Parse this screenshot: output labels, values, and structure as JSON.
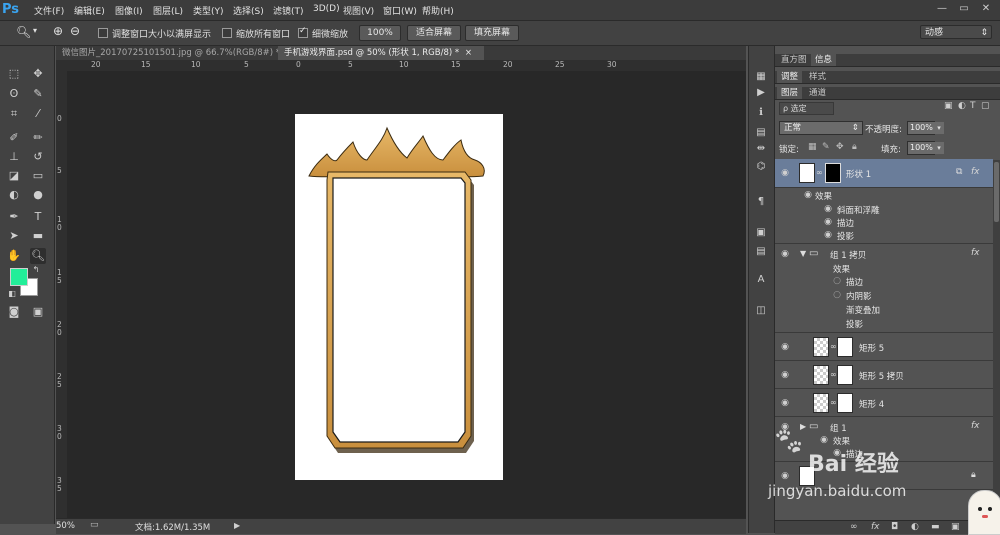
{
  "menubar": {
    "logo": "Ps",
    "items": [
      "文件(F)",
      "编辑(E)",
      "图像(I)",
      "图层(L)",
      "类型(Y)",
      "选择(S)",
      "滤镜(T)",
      "3D(D)",
      "视图(V)",
      "窗口(W)",
      "帮助(H)"
    ],
    "win_controls": [
      "—",
      "▭",
      "✕"
    ]
  },
  "options": {
    "check_resize": "调整窗口大小以满屏显示",
    "check_all_windows": "缩放所有窗口",
    "check_scrubby": "细微缩放",
    "btn_100": "100%",
    "btn_fit": "适合屏幕",
    "btn_fill": "填充屏幕",
    "workspace": "动感"
  },
  "tabs": [
    {
      "label": "微信图片_20170725101501.jpg @ 66.7%(RGB/8#) *",
      "close": "×"
    },
    {
      "label": "手机游戏界面.psd @ 50% (形状 1, RGB/8) *",
      "close": "×"
    }
  ],
  "ruler": {
    "top": [
      "20",
      "15",
      "10",
      "5",
      "0",
      "5",
      "10",
      "15",
      "20",
      "25",
      "30"
    ],
    "left": [
      "0",
      "5",
      "1",
      "0",
      "1",
      "5",
      "2",
      "0",
      "2",
      "5",
      "3",
      "0",
      "3",
      "5"
    ]
  },
  "status": {
    "zoom": "50%",
    "doc": "文档:1.62M/1.35M"
  },
  "panels": {
    "row1_tabs": [
      "直方图",
      "信息"
    ],
    "row2_tabs": [
      "调整",
      "样式"
    ],
    "row3_tabs": [
      "图层",
      "通道"
    ],
    "filter_label": "ρ 选定",
    "blend_mode": "正常",
    "opacity_label": "不透明度:",
    "opacity_value": "100%",
    "lock_label": "锁定:",
    "fill_label": "填充:",
    "fill_value": "100%"
  },
  "layers": [
    {
      "name": "形状 1",
      "fx": "fx",
      "effects_label": "效果",
      "effects": [
        "斜面和浮雕",
        "描边",
        "投影"
      ]
    },
    {
      "name": "组 1 拷贝",
      "fx": "fx",
      "effects_label": "效果",
      "effects": [
        "描边",
        "内阴影",
        "渐变叠加",
        "投影"
      ]
    },
    {
      "name": "矩形 5"
    },
    {
      "name": "矩形 5 拷贝"
    },
    {
      "name": "矩形 4"
    },
    {
      "name": "组 1",
      "fx": "fx",
      "effects_label": "效果",
      "effects": [
        "描边"
      ]
    }
  ],
  "watermark": {
    "brand": "Bai 经验",
    "url": "jingyan.baidu.com"
  },
  "colors": {
    "foreground": "#22ee99",
    "background": "#ffffff",
    "frame_gold": "#d9a657",
    "selected_layer": "#6a7d9a"
  }
}
